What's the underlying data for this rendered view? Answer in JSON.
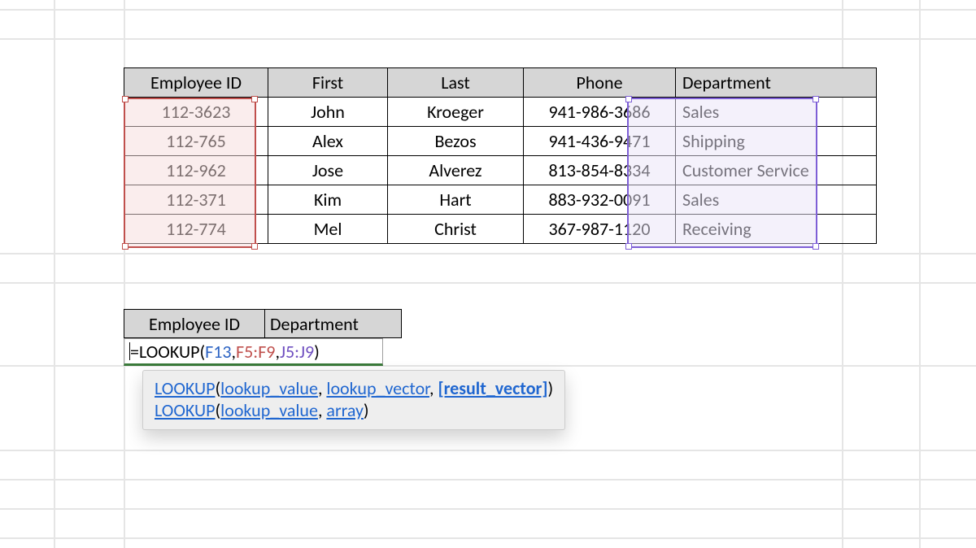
{
  "table": {
    "headers": [
      "Employee ID",
      "First",
      "Last",
      "Phone",
      "Department"
    ],
    "rows": [
      {
        "id": "112-3623",
        "first": "John",
        "last": "Kroeger",
        "phone": "941-986-3686",
        "dept": "Sales"
      },
      {
        "id": "112-765",
        "first": "Alex",
        "last": "Bezos",
        "phone": "941-436-9471",
        "dept": "Shipping"
      },
      {
        "id": "112-962",
        "first": "Jose",
        "last": "Alverez",
        "phone": "813-854-8334",
        "dept": "Customer Service"
      },
      {
        "id": "112-371",
        "first": "Kim",
        "last": "Hart",
        "phone": "883-932-0091",
        "dept": "Sales"
      },
      {
        "id": "112-774",
        "first": "Mel",
        "last": "Christ",
        "phone": "367-987-1120",
        "dept": "Receiving"
      }
    ]
  },
  "lookup_headers": {
    "a": "Employee ID",
    "b": "Department"
  },
  "formula": {
    "prefix": "=LOOKUP(",
    "arg1": "F13",
    "sep1": ",",
    "arg2": "F5:F9",
    "sep2": ",",
    "arg3": "J5:J9",
    "suffix": ")"
  },
  "tooltip": {
    "line1": {
      "fn": "LOOKUP",
      "a1": "lookup_value",
      "a2": "lookup_vector",
      "a3": "[result_vector]"
    },
    "line2": {
      "fn": "LOOKUP",
      "a1": "lookup_value",
      "a2": "array"
    }
  }
}
